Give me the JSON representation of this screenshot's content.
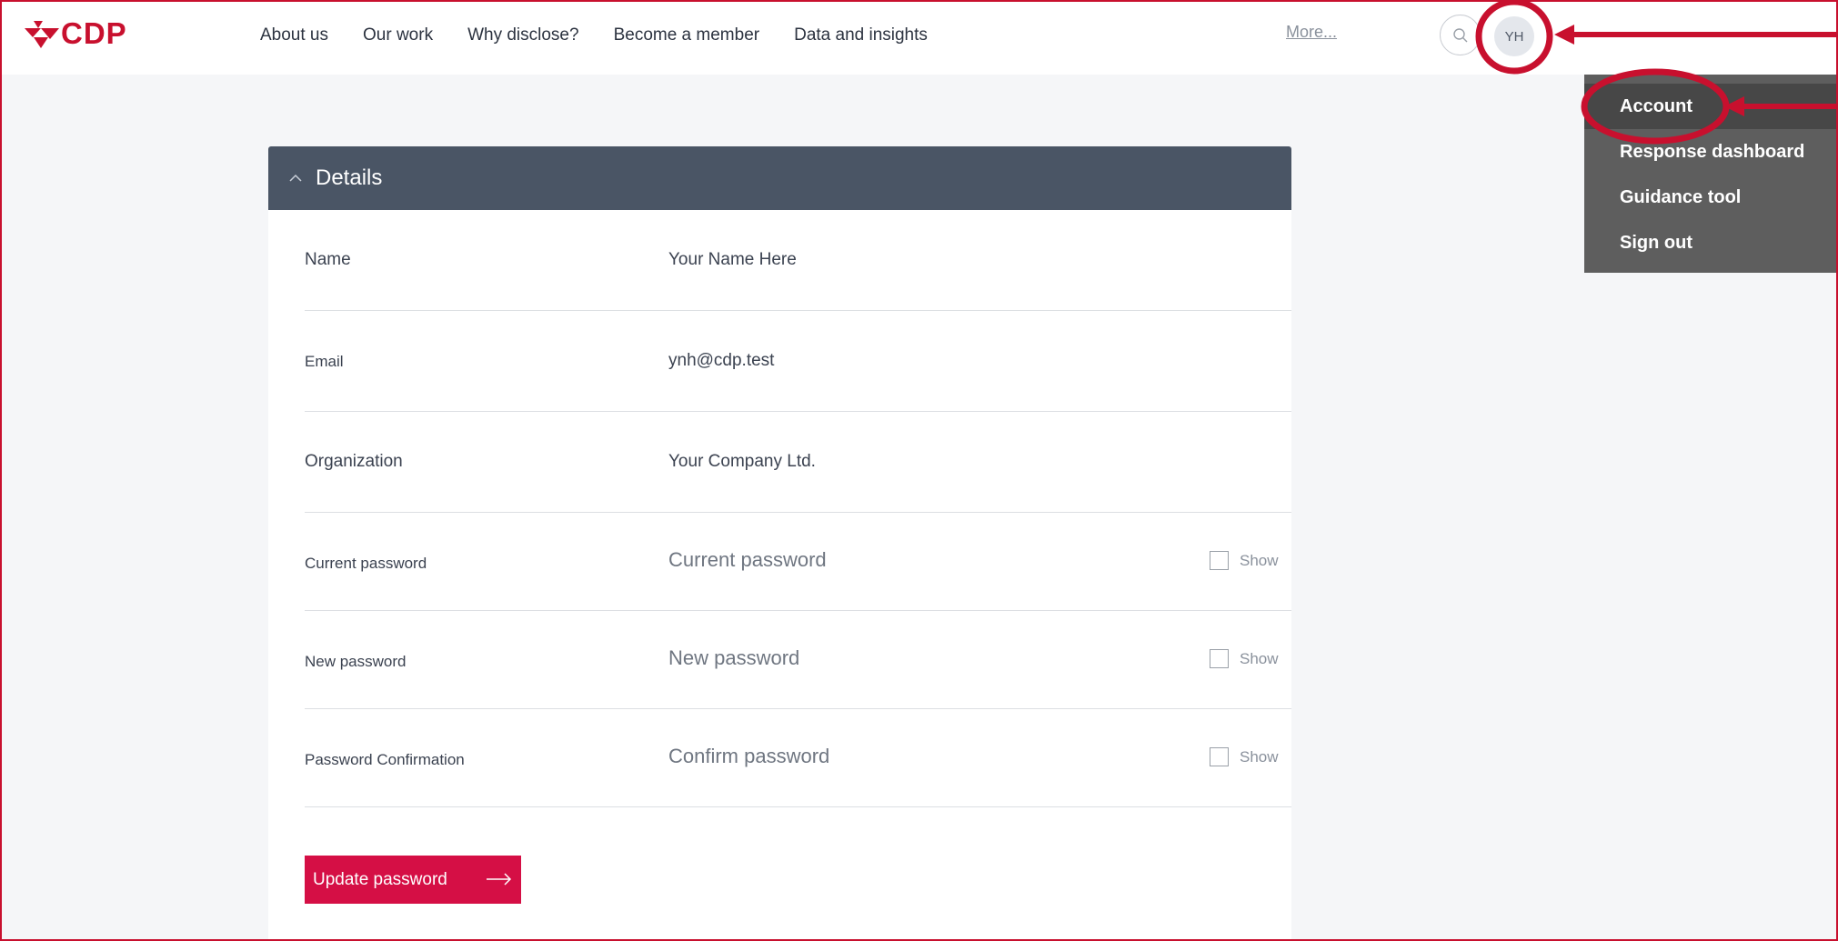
{
  "header": {
    "logo_text": "CDP",
    "nav": [
      "About us",
      "Our work",
      "Why disclose?",
      "Become a member",
      "Data and insights"
    ],
    "more_label": "More...",
    "avatar_initials": "YH"
  },
  "account_menu": {
    "items": [
      "Account",
      "Response dashboard",
      "Guidance tool",
      "Sign out"
    ],
    "active_item": "Account"
  },
  "details": {
    "title": "Details",
    "name_label": "Name",
    "name_value": "Your Name Here",
    "email_label": "Email",
    "email_value": "ynh@cdp.test",
    "organization_label": "Organization",
    "organization_value": "Your Company Ltd.",
    "current_password_label": "Current password",
    "current_password_placeholder": "Current password",
    "new_password_label": "New password",
    "new_password_placeholder": "New password",
    "confirm_password_label": "Password Confirmation",
    "confirm_password_placeholder": "Confirm password",
    "show_label": "Show",
    "update_button": "Update password"
  },
  "colors": {
    "brand_red": "#c8102e",
    "button_red": "#d50f45",
    "panel_header": "#4a5565",
    "menu_bg": "#5e5e5e",
    "annotation_red": "#c8102e"
  }
}
